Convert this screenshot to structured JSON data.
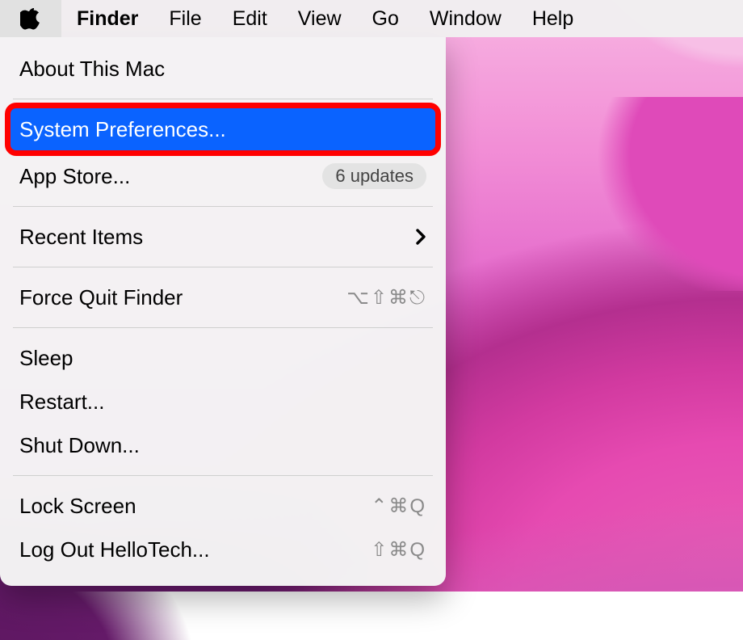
{
  "menubar": {
    "apple": "",
    "items": [
      "Finder",
      "File",
      "Edit",
      "View",
      "Go",
      "Window",
      "Help"
    ]
  },
  "apple_menu": {
    "about": "About This Mac",
    "system_preferences": "System Preferences...",
    "app_store": "App Store...",
    "app_store_badge": "6 updates",
    "recent_items": "Recent Items",
    "force_quit": "Force Quit Finder",
    "force_quit_shortcut": "⌥⇧⌘⎋",
    "sleep": "Sleep",
    "restart": "Restart...",
    "shut_down": "Shut Down...",
    "lock_screen": "Lock Screen",
    "lock_screen_shortcut": "⌃⌘Q",
    "log_out": "Log Out HelloTech...",
    "log_out_shortcut": "⇧⌘Q"
  }
}
